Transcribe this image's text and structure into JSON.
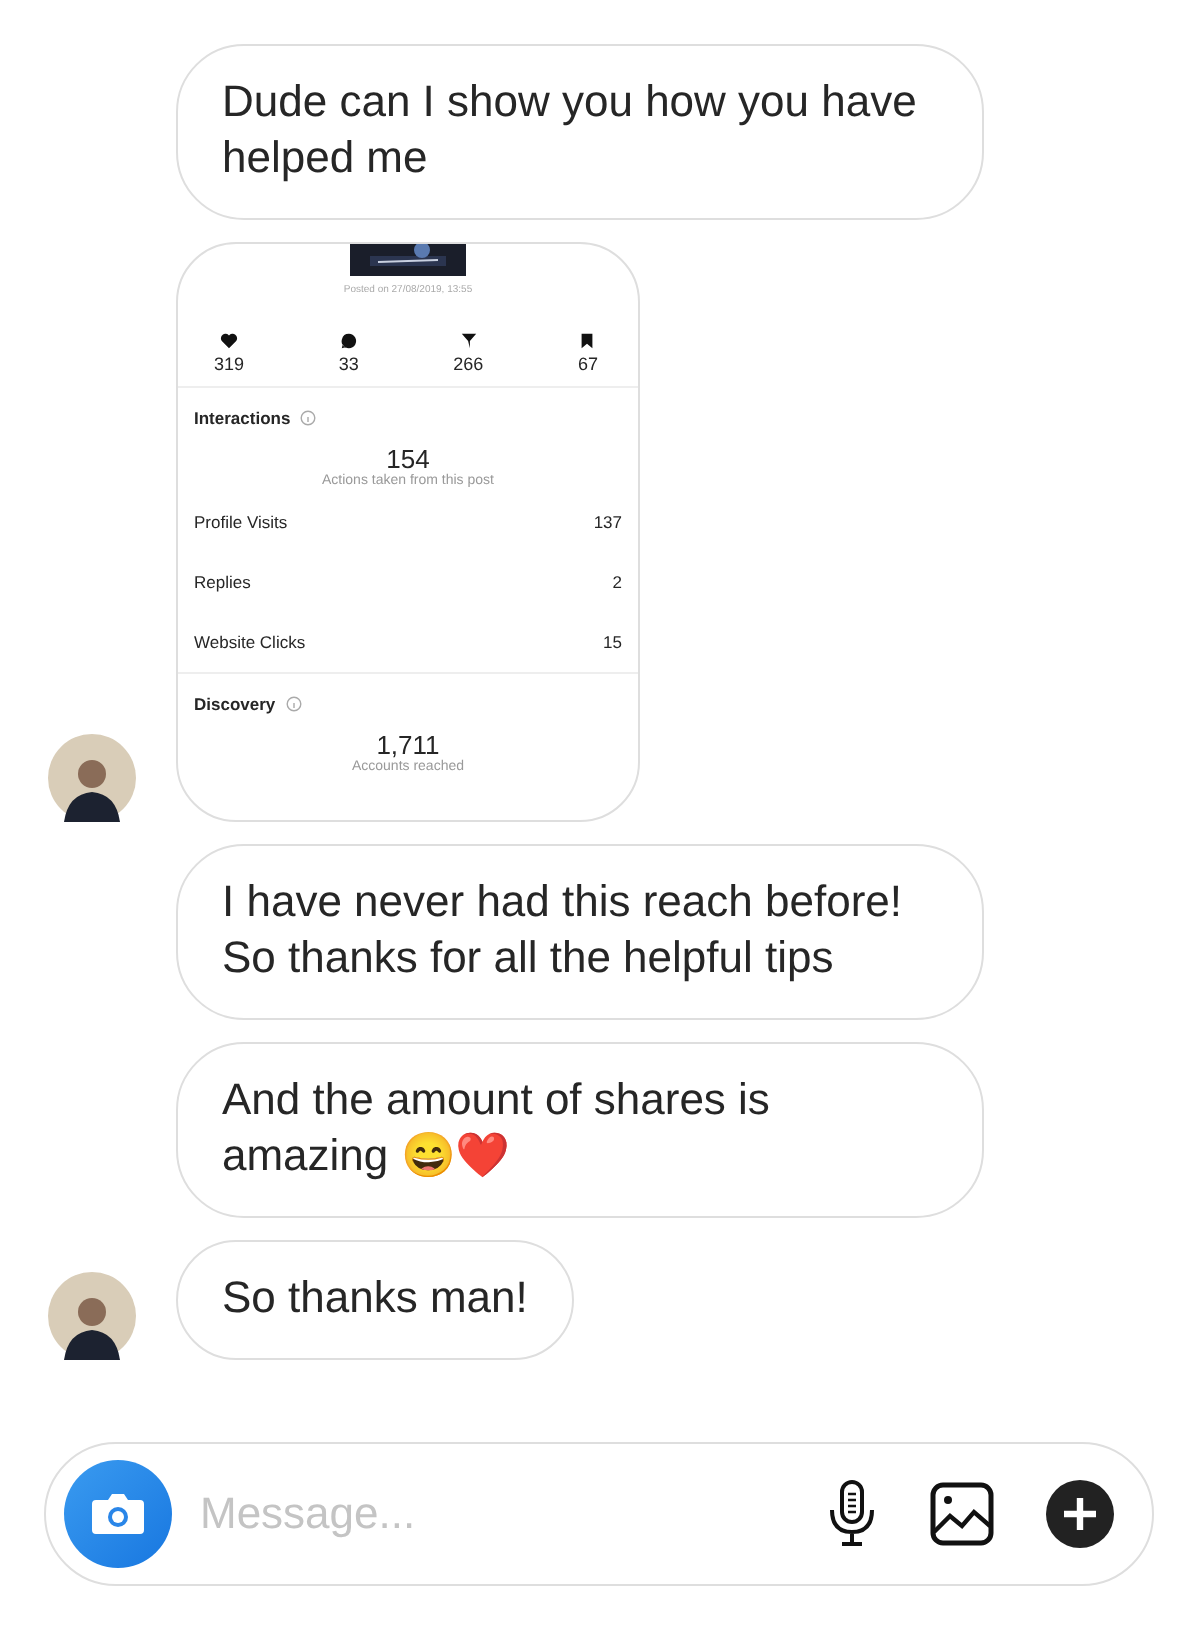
{
  "messages": [
    {
      "kind": "text",
      "text": "Dude can I show you how you have helped me",
      "show_avatar": false
    },
    {
      "kind": "screenshot",
      "show_avatar": true,
      "posted": "Posted on 27/08/2019, 13:55",
      "stats": [
        {
          "value": "319"
        },
        {
          "value": "33"
        },
        {
          "value": "266"
        },
        {
          "value": "67"
        }
      ],
      "interactions": {
        "title": "Interactions",
        "total": "154",
        "caption": "Actions taken from this post",
        "rows": [
          {
            "label": "Profile Visits",
            "value": "137"
          },
          {
            "label": "Replies",
            "value": "2"
          },
          {
            "label": "Website Clicks",
            "value": "15"
          }
        ]
      },
      "discovery": {
        "title": "Discovery",
        "total": "1,711",
        "caption": "Accounts reached"
      }
    },
    {
      "kind": "text",
      "text": "I have never had this reach before! So thanks for all the helpful tips",
      "show_avatar": false
    },
    {
      "kind": "text",
      "text": "And the amount of shares is amazing 😄❤️",
      "show_avatar": false
    },
    {
      "kind": "text",
      "text": "So thanks man!",
      "show_avatar": true
    }
  ],
  "composer": {
    "placeholder": "Message..."
  }
}
